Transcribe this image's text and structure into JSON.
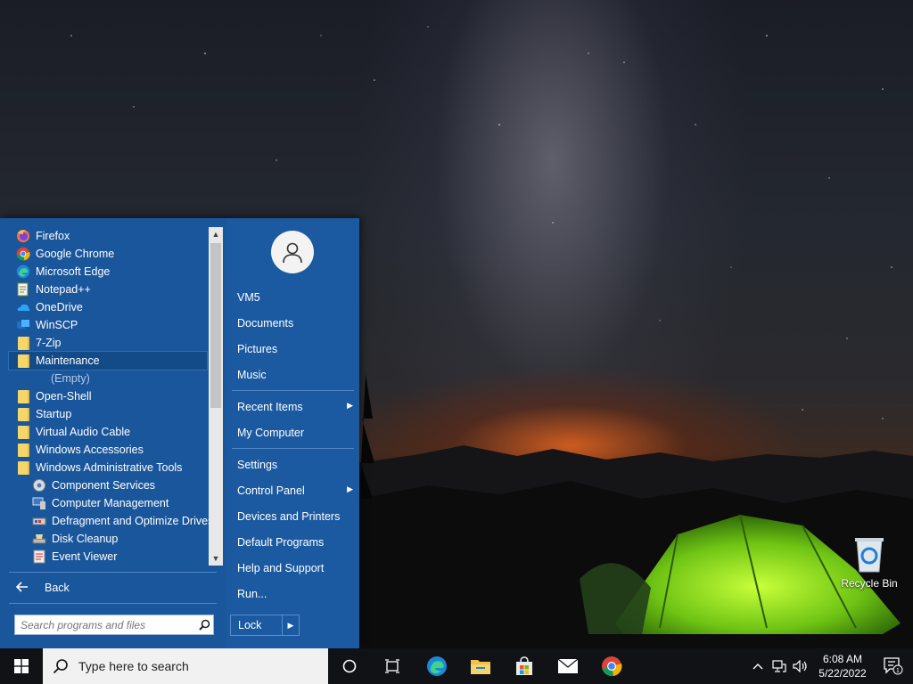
{
  "desktop": {
    "recycle_bin_label": "Recycle Bin"
  },
  "start_menu": {
    "programs": [
      {
        "label": "Firefox",
        "icon": "firefox-icon",
        "level": 0
      },
      {
        "label": "Google Chrome",
        "icon": "chrome-icon",
        "level": 0
      },
      {
        "label": "Microsoft Edge",
        "icon": "edge-icon",
        "level": 0
      },
      {
        "label": "Notepad++",
        "icon": "notepadpp-icon",
        "level": 0
      },
      {
        "label": "OneDrive",
        "icon": "onedrive-icon",
        "level": 0
      },
      {
        "label": "WinSCP",
        "icon": "winscp-icon",
        "level": 0
      },
      {
        "label": "7-Zip",
        "icon": "folder-icon",
        "level": 0
      },
      {
        "label": "Maintenance",
        "icon": "folder-icon",
        "level": 0,
        "selected": true
      },
      {
        "label": "(Empty)",
        "icon": "",
        "level": 1
      },
      {
        "label": "Open-Shell",
        "icon": "folder-icon",
        "level": 0
      },
      {
        "label": "Startup",
        "icon": "folder-icon",
        "level": 0
      },
      {
        "label": "Virtual Audio Cable",
        "icon": "folder-icon",
        "level": 0
      },
      {
        "label": "Windows Accessories",
        "icon": "folder-icon",
        "level": 0
      },
      {
        "label": "Windows Administrative Tools",
        "icon": "folder-icon",
        "level": 0
      },
      {
        "label": "Component Services",
        "icon": "component-services-icon",
        "level": 1
      },
      {
        "label": "Computer Management",
        "icon": "computer-management-icon",
        "level": 1
      },
      {
        "label": "Defragment and Optimize Drives",
        "icon": "defragment-icon",
        "level": 1
      },
      {
        "label": "Disk Cleanup",
        "icon": "disk-cleanup-icon",
        "level": 1
      },
      {
        "label": "Event Viewer",
        "icon": "event-viewer-icon",
        "level": 1
      }
    ],
    "back_label": "Back",
    "search_placeholder": "Search programs and files",
    "places": {
      "user": "VM5",
      "documents": "Documents",
      "pictures": "Pictures",
      "music": "Music",
      "recent_items": "Recent Items",
      "my_computer": "My Computer",
      "settings": "Settings",
      "control_panel": "Control Panel",
      "devices_printers": "Devices and Printers",
      "default_programs": "Default Programs",
      "help_support": "Help and Support",
      "run": "Run..."
    },
    "lock_label": "Lock"
  },
  "taskbar": {
    "search_placeholder": "Type here to search",
    "pinned": [
      "cortana-icon",
      "task-view-icon",
      "edge-icon",
      "file-explorer-icon",
      "store-icon",
      "mail-icon",
      "chrome-icon"
    ],
    "time": "6:08 AM",
    "date": "5/22/2022",
    "notification_count": "1"
  },
  "colors": {
    "menu_bg": "#1a569b",
    "taskbar_bg": "#101216",
    "selection": "#134a88"
  }
}
